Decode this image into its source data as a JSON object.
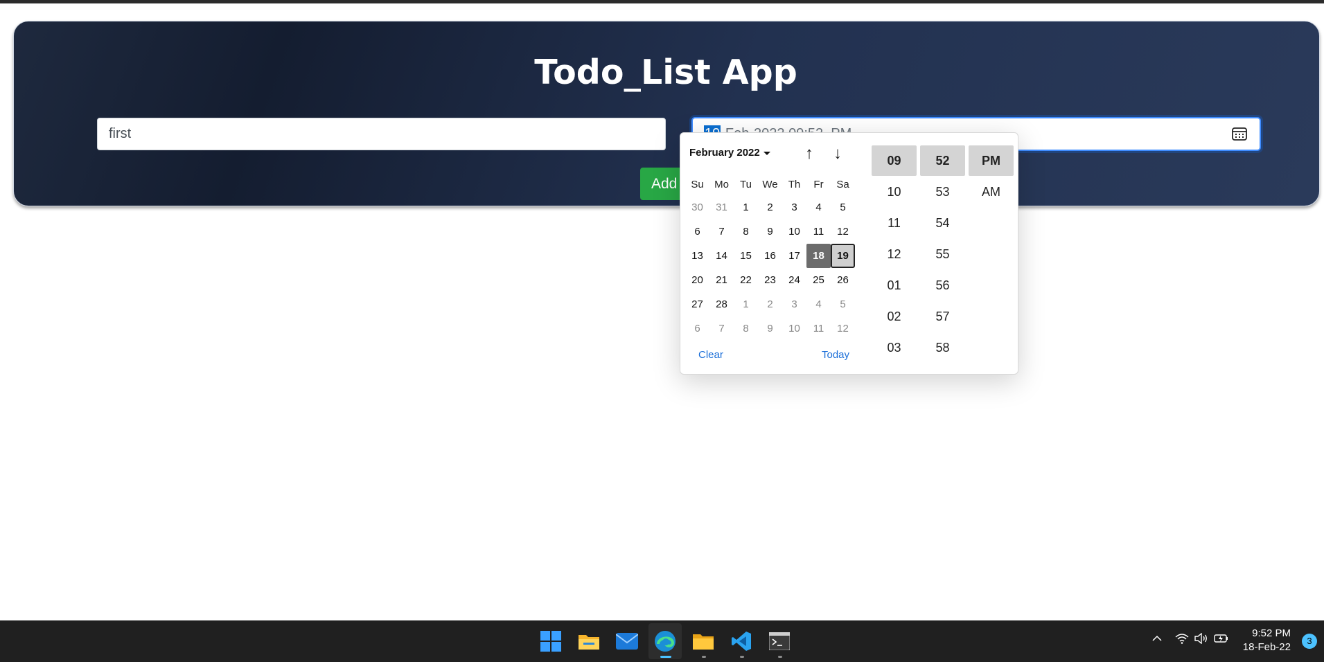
{
  "app": {
    "title": "Todo_List App",
    "task_input_value": "first",
    "date_input": {
      "selected_segment": "19",
      "rest": "-Feb-2022 09:52  PM"
    },
    "add_button_label": "Add Ta"
  },
  "datepicker": {
    "month_label": "February 2022",
    "nav_up": "↑",
    "nav_down": "↓",
    "weekdays": [
      "Su",
      "Mo",
      "Tu",
      "We",
      "Th",
      "Fr",
      "Sa"
    ],
    "weeks": [
      [
        "30",
        "31",
        "1",
        "2",
        "3",
        "4",
        "5"
      ],
      [
        "6",
        "7",
        "8",
        "9",
        "10",
        "11",
        "12"
      ],
      [
        "13",
        "14",
        "15",
        "16",
        "17",
        "18",
        "19"
      ],
      [
        "20",
        "21",
        "22",
        "23",
        "24",
        "25",
        "26"
      ],
      [
        "27",
        "28",
        "1",
        "2",
        "3",
        "4",
        "5"
      ],
      [
        "6",
        "7",
        "8",
        "9",
        "10",
        "11",
        "12"
      ]
    ],
    "clear_label": "Clear",
    "today_label": "Today",
    "hours": [
      "09",
      "10",
      "11",
      "12",
      "01",
      "02",
      "03"
    ],
    "minutes": [
      "52",
      "53",
      "54",
      "55",
      "56",
      "57",
      "58"
    ],
    "meridiem": [
      "PM",
      "AM"
    ]
  },
  "taskbar": {
    "clock_time": "9:52 PM",
    "clock_date": "18-Feb-22",
    "notification_count": "3",
    "apps": [
      "start-icon",
      "file-explorer-icon",
      "mail-icon",
      "edge-icon",
      "folder-icon",
      "vscode-icon",
      "terminal-icon"
    ]
  },
  "colors": {
    "header_bg": "#1e2b44",
    "add_button": "#28a745",
    "link": "#1a6ed8",
    "selection": "#0a6ed1"
  }
}
